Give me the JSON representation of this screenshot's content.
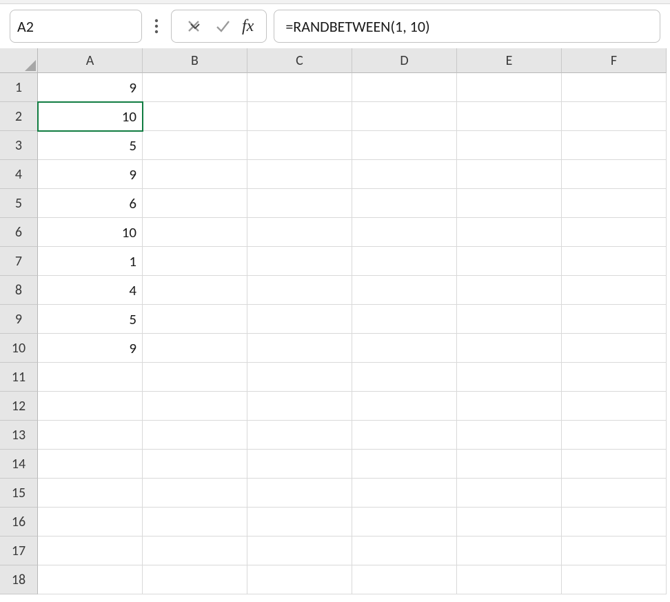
{
  "name_box": {
    "value": "A2"
  },
  "formula_bar": {
    "value": "=RANDBETWEEN(1, 10)",
    "fx_label": "fx"
  },
  "columns": [
    "A",
    "B",
    "C",
    "D",
    "E",
    "F"
  ],
  "visible_row_count": 18,
  "active_cell": {
    "row": 2,
    "col": 1
  },
  "cells": {
    "A1": "9",
    "A2": "10",
    "A3": "5",
    "A4": "9",
    "A5": "6",
    "A6": "10",
    "A7": "1",
    "A8": "4",
    "A9": "5",
    "A10": "9"
  }
}
